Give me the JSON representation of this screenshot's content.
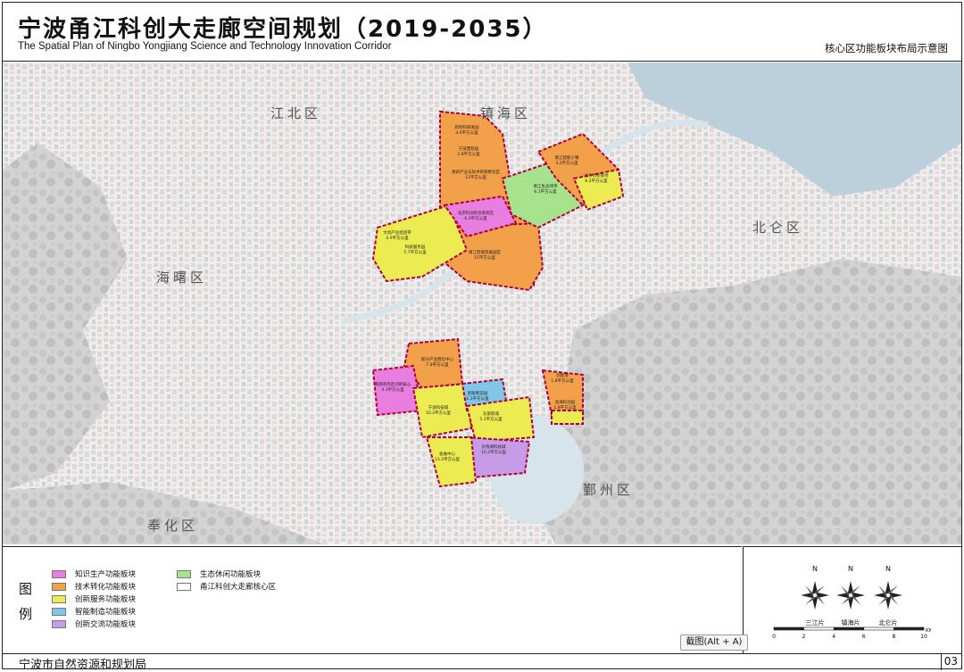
{
  "header": {
    "title": "宁波甬江科创大走廊空间规划（2019-2035）",
    "subtitle": "The Spatial Plan of Ningbo Yongjiang Science and Technology Innovation Corridor",
    "sheet_title": "核心区功能板块布局示意图"
  },
  "map": {
    "district_labels": [
      "江北区",
      "镇海区",
      "北仑区",
      "海曙区",
      "鄞州区",
      "奉化区"
    ],
    "blocks": [
      {
        "name": "新材料研发园",
        "area": "4.6平方公里"
      },
      {
        "name": "宁波慧智园",
        "area": "2.8平方公里"
      },
      {
        "name": "甬新产业与技术研发孵化区",
        "area": "11平方公里"
      },
      {
        "name": "北岸科创综合商贸区",
        "area": "6.3平方公里"
      },
      {
        "name": "文创产业组团带",
        "area": "4.9平方公里"
      },
      {
        "name": "科技服务园",
        "area": "5.7平方公里"
      },
      {
        "name": "甬江智能装备园区",
        "area": "15平方公里"
      },
      {
        "name": "甬江生态绿带",
        "area": "6.1平方公里"
      },
      {
        "name": "甬江智能小镇",
        "area": "3.2平方公里"
      },
      {
        "name": "北仑创新基地",
        "area": "6.2平方公里"
      },
      {
        "name": "新兴产业孵化中心",
        "area": "7.8平方公里"
      },
      {
        "name": "南部商务区创新核心",
        "area": "4.3平方公里"
      },
      {
        "name": "宁波科技城",
        "area": "10.3平方公里"
      },
      {
        "name": "智能制造园",
        "area": "2.3平方公里"
      },
      {
        "name": "东部新城",
        "area": "5.1平方公里"
      },
      {
        "name": "创新港",
        "area": "1.8平方公里"
      },
      {
        "name": "滨海科创园",
        "area": "1.8平方公里"
      },
      {
        "name": "东钱湖科技城",
        "area": "10.3平方公里"
      },
      {
        "name": "会展中心",
        "area": "13.3平方公里"
      }
    ]
  },
  "legend": {
    "heading_1": "图",
    "heading_2": "例",
    "items": [
      {
        "label": "知识生产功能板块",
        "color": "#e87ee0"
      },
      {
        "label": "技术转化功能板块",
        "color": "#f2a04a"
      },
      {
        "label": "创新服务功能板块",
        "color": "#ecec52"
      },
      {
        "label": "智能制造功能板块",
        "color": "#7fc6e8"
      },
      {
        "label": "创新交流功能板块",
        "color": "#c79ce6"
      },
      {
        "label": "生态休闲功能板块",
        "color": "#a6e38c"
      },
      {
        "label": "甬江科创大走廊核心区",
        "color": "#ffffff"
      }
    ]
  },
  "wind_roses": [
    {
      "north": "N",
      "label": "三江片"
    },
    {
      "north": "N",
      "label": "镇海片"
    },
    {
      "north": "N",
      "label": "北仑片"
    }
  ],
  "scale_bar": {
    "ticks": [
      "0",
      "2",
      "4",
      "6",
      "8",
      "10"
    ],
    "unit": "KM"
  },
  "screenshot_button": "截图(Alt + A)",
  "footer": {
    "org": "宁波市自然资源和规划局",
    "page": "03"
  },
  "colors": {
    "boundary": "#b0003a",
    "river": "#d8e4ec",
    "sea": "#bcd0dc"
  }
}
